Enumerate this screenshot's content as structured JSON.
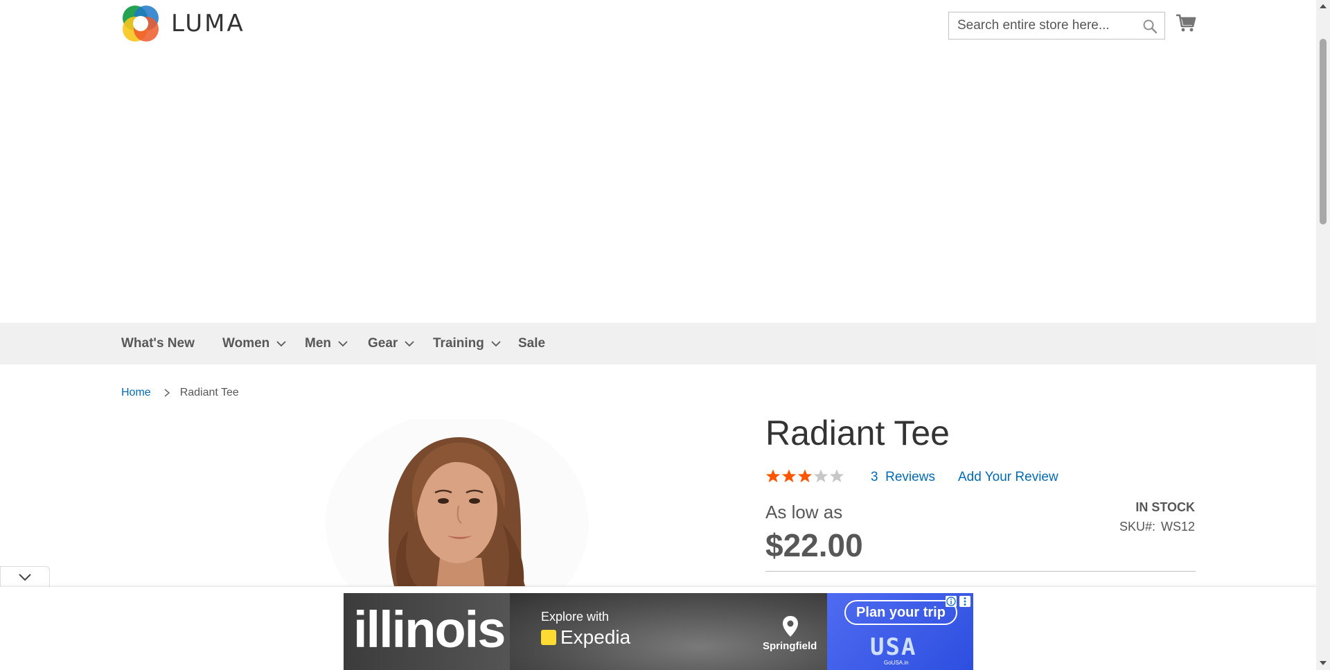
{
  "header": {
    "logo_text": "LUMA",
    "search_placeholder": "Search entire store here..."
  },
  "nav": {
    "items": [
      {
        "label": "What's New"
      },
      {
        "label": "Women"
      },
      {
        "label": "Men"
      },
      {
        "label": "Gear"
      },
      {
        "label": "Training"
      },
      {
        "label": "Sale"
      }
    ]
  },
  "breadcrumb": {
    "home": "Home",
    "current": "Radiant Tee"
  },
  "product": {
    "title": "Radiant Tee",
    "rating_stars": 3,
    "rating_max": 5,
    "reviews_count": "3",
    "reviews_label": "Reviews",
    "add_review": "Add Your Review",
    "price_prefix": "As low as",
    "price": "$22.00",
    "stock": "IN STOCK",
    "sku_label": "SKU#:",
    "sku_value": "WS12"
  },
  "ad": {
    "headline": "illinois",
    "explore": "Explore with",
    "partner": "Expedia",
    "city": "Springfield",
    "cta": "Plan your trip",
    "brand": "USA",
    "brand_small": "GoUSA.in"
  },
  "colors": {
    "link": "#006bb4",
    "star_filled": "#ff5501",
    "star_empty": "#c7c7c7",
    "nav_bg": "#f0f0f0"
  }
}
